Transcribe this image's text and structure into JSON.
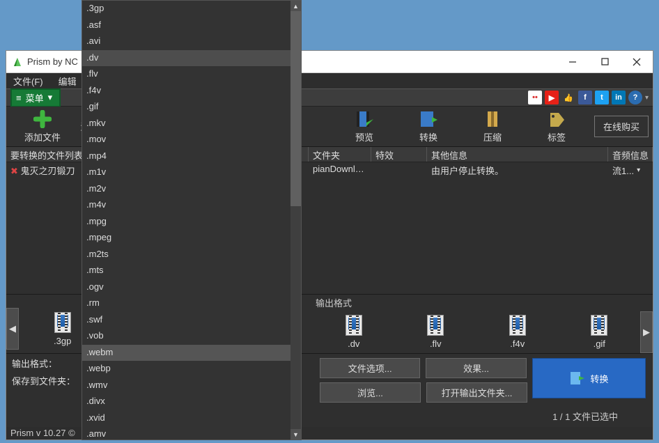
{
  "window": {
    "title": "Prism by NC"
  },
  "menubar": {
    "file": "文件(F)",
    "edit": "编辑"
  },
  "green_menu": {
    "lines": "≡",
    "label": "菜单",
    "arrow": "▾"
  },
  "toolbar": {
    "add_file": "添加文件",
    "add_prefix": "添",
    "preview": "预览",
    "convert": "转换",
    "compress": "压缩",
    "tag": "标签",
    "online_buy": "在线购买"
  },
  "columns": {
    "list_title": "要转换的文件列表",
    "folder": "文件夹",
    "effects": "特效",
    "other": "其他信息",
    "audio": "音频信息"
  },
  "file_row": {
    "name": "鬼灭之刃锻刀",
    "folder": "pianDownlo...",
    "other": "由用户停止转换。",
    "audio": "流1..."
  },
  "output_label": "输出格式",
  "thumbs_left": [
    ".3gp"
  ],
  "thumbs_right": [
    ".dv",
    ".flv",
    ".f4v",
    ".gif"
  ],
  "bottom": {
    "output_fmt": "输出格式：",
    "save_to": "保存到文件夹：",
    "file_options": "文件选项...",
    "effects": "效果...",
    "browse": "浏览...",
    "open_output": "打开输出文件夹...",
    "convert": "转换"
  },
  "status": "1 / 1 文件已选中",
  "version": "Prism v 10.27 ©",
  "dropdown": {
    "items": [
      ".3gp",
      ".asf",
      ".avi",
      ".dv",
      ".flv",
      ".f4v",
      ".gif",
      ".mkv",
      ".mov",
      ".mp4",
      ".m1v",
      ".m2v",
      ".m4v",
      ".mpg",
      ".mpeg",
      ".m2ts",
      ".mts",
      ".ogv",
      ".rm",
      ".swf",
      ".vob",
      ".webm",
      ".webp",
      ".wmv",
      ".divx",
      ".xvid",
      ".amv"
    ],
    "selected": ".dv",
    "hover": ".webm"
  },
  "icons": {
    "help": "?"
  }
}
